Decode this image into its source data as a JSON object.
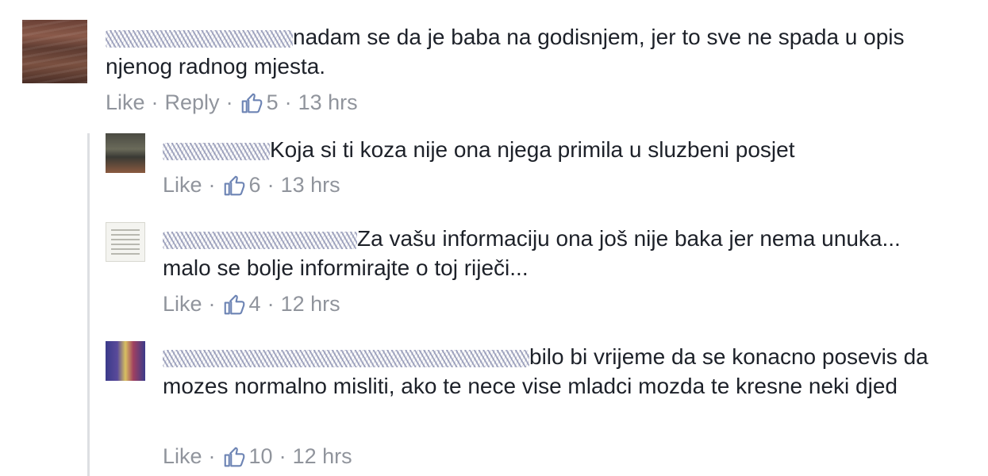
{
  "comments": [
    {
      "text": "nadam se da je baba na godisnjem, jer to sve ne spada u opis njenog radnog mjesta.",
      "like": "Like",
      "reply": "Reply",
      "likes": "5",
      "time": "13 hrs"
    },
    {
      "text": "Koja si ti koza nije ona njega primila u sluzbeni posjet",
      "like": "Like",
      "likes": "6",
      "time": "13 hrs"
    },
    {
      "text": "Za vašu informaciju ona još nije baka jer nema unuka... malo se bolje informirajte o toj riječi...",
      "like": "Like",
      "likes": "4",
      "time": "12 hrs"
    },
    {
      "text": "bilo bi vrijeme da se konacno posevis da mozes normalno misliti, ako te nece vise mladci mozda te kresne neki djed",
      "like": "Like",
      "likes": "10",
      "time": "12 hrs"
    }
  ],
  "separator": "·",
  "colors": {
    "meta": "#90949c",
    "text": "#1d2129",
    "thread_line": "#dddfe2"
  },
  "icons": {
    "like": "thumbs-up-outline-icon"
  }
}
